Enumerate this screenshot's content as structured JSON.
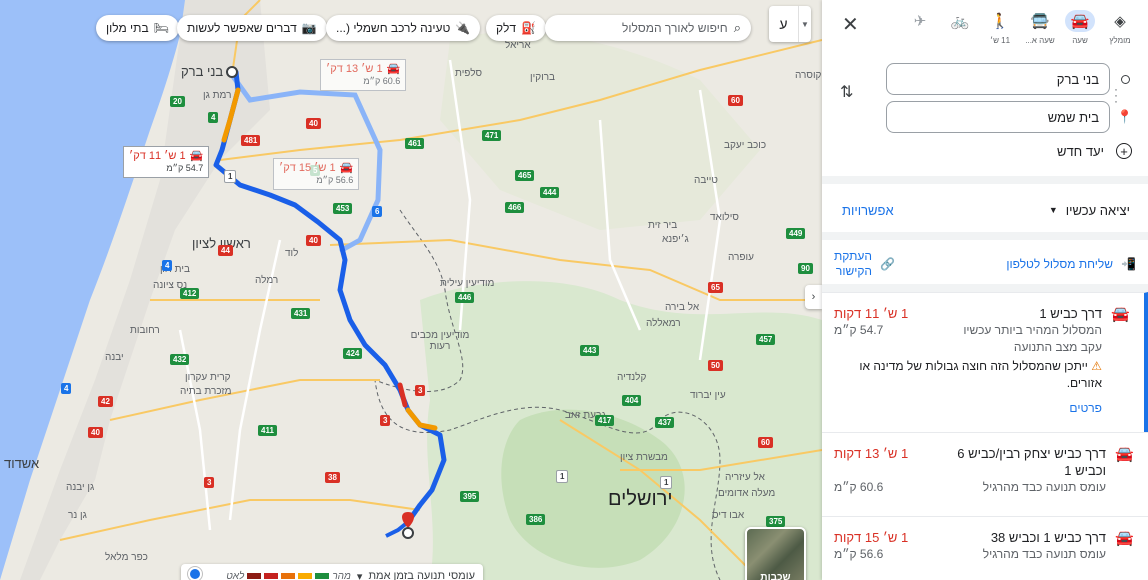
{
  "map": {
    "search_placeholder": "חיפוש לאורך המסלול",
    "lang_button": "ע",
    "chips": [
      {
        "label": "דלק",
        "icon": "fuel-icon"
      },
      {
        "label": "טעינה לרכב חשמלי (...",
        "icon": "ev-charger-icon"
      },
      {
        "label": "דברים שאפשר לעשות",
        "icon": "camera-icon"
      },
      {
        "label": "בתי מלון",
        "icon": "bed-icon"
      }
    ],
    "callouts": [
      {
        "time": "1 ש׳ 11 דק׳",
        "distance": "54.7 ק״מ"
      },
      {
        "time": "1 ש׳ 15 דק׳",
        "distance": "56.6 ק״מ"
      },
      {
        "time": "1 ש׳ 13 דק׳",
        "distance": "60.6 ק״מ"
      }
    ],
    "traffic": {
      "label": "עומסי תנועה בזמן אמת",
      "fast": "מהר",
      "slow": "לאט"
    },
    "satellite_label": "שכבות",
    "places": {
      "bnei_brak": "בני ברק",
      "ramat_gan": "רמת גן",
      "rishon": "ראשון לציון",
      "jerusalem": "ירושלים",
      "ashdod": "אשדוד",
      "ramla": "רמלה",
      "lod": "לוד",
      "modiin": "מודיעין מכבים רעות",
      "givat_zeev": "גבעת זאב",
      "kalandia": "קלנדיה",
      "beit_shemesh": "בית שמש",
      "rehovot": "רחובות",
      "yavne": "יבנה",
      "nes_ziona": "נס ציונה",
      "gan_yavne": "גן יבנה",
      "sulfit": "סלפית",
      "bruqin": "ברוקין",
      "kfar_saba": "קוסרה",
      "ariel": "אריאל",
      "bir_zeit": "ביר זית",
      "jifna": "ג׳יפנא",
      "ramallah": "רמאללה",
      "silwad": "סילואד",
      "al_bireh": "אל בירה",
      "ofra": "עופרה",
      "mevaseret": "מבשרת ציון",
      "abu_dis": "אבו דיס",
      "maale_adumim": "מעלה אדומים",
      "kiryat_ekron": "קרית עקרון",
      "mazkeret": "מזכרת בתיה",
      "modiin_illit": "מודיעין עילית",
      "kochav_yaakov": "כוכב יעקב",
      "beit_dagan": "בית דגן",
      "kfar_malal": "כפר מלאל",
      "gan_ner": "גן נר",
      "izariya": "אל עיזריה",
      "taybeh": "טייבה",
      "ein_yabrud": "עין יברוד"
    },
    "shields": [
      "20",
      "481",
      "4",
      "1",
      "44",
      "40",
      "471",
      "461",
      "465",
      "453",
      "5",
      "6",
      "466",
      "446",
      "444",
      "449",
      "60",
      "65",
      "40",
      "431",
      "412",
      "4",
      "424",
      "3",
      "3",
      "42",
      "40",
      "411",
      "432",
      "4",
      "38",
      "395",
      "386",
      "1",
      "437",
      "417",
      "457",
      "404",
      "375",
      "60",
      "90",
      "443",
      "3",
      "50",
      "1"
    ]
  },
  "panel": {
    "modes": [
      {
        "label": "מומלץ",
        "icon": "directions-diamond-icon"
      },
      {
        "label": "שעה",
        "icon": "car-icon"
      },
      {
        "label": "שעה א...",
        "icon": "bus-icon"
      },
      {
        "label": "11 ש׳",
        "icon": "walk-icon"
      },
      {
        "label": "",
        "icon": "bike-icon"
      },
      {
        "label": "",
        "icon": "plane-icon"
      }
    ],
    "origin": "בני ברק",
    "destination": "בית שמש",
    "add_destination": "יעד חדש",
    "leave_now": "יציאה עכשיו",
    "options": "אפשרויות",
    "send_to_phone": "שליחת מסלול לטלפון",
    "copy_link_1": "העתקת",
    "copy_link_2": "הקישור",
    "routes": [
      {
        "name": "דרך כביש 1",
        "time": "1 ש׳ 11 דקות",
        "subtitle": "המסלול המהיר ביותר עכשיו עקב מצב התנועה",
        "distance": "54.7 ק״מ",
        "warning": "ייתכן שהמסלול הזה חוצה גבולות של מדינה או אזורים.",
        "details": "פרטים"
      },
      {
        "name": "דרך כביש יצחק רבין/כביש 6 וכביש 1",
        "time": "1 ש׳ 13 דקות",
        "subtitle": "עומס תנועה כבד מהרגיל",
        "distance": "60.6 ק״מ"
      },
      {
        "name": "דרך כביש 1 וכביש 38",
        "time": "1 ש׳ 15 דקות",
        "subtitle": "עומס תנועה כבד מהרגיל",
        "distance": "56.6 ק״מ"
      }
    ]
  },
  "colors": {
    "route_primary": "#1a5fe8",
    "route_alt": "#8ab4f8",
    "traffic_red": "#d93025",
    "traffic_orange": "#f29900",
    "accent": "#1a73e8",
    "time_red": "#d93025"
  }
}
